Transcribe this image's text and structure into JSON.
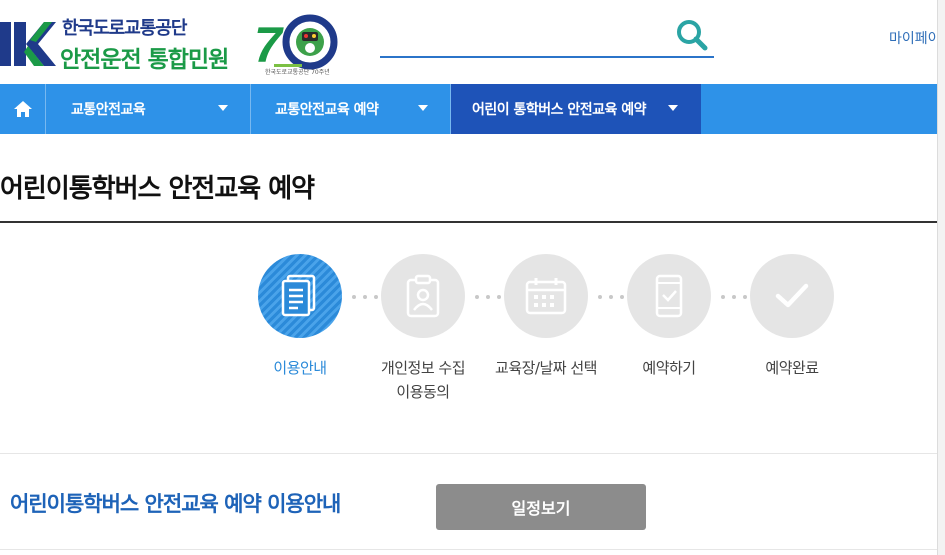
{
  "header": {
    "org_name": "한국도로교통공단",
    "site_name": "안전운전 통합민원",
    "anniversary_caption": "한국도로교통공단 70주년",
    "search": {
      "value": "",
      "placeholder": ""
    },
    "mypage_label": "마이페이"
  },
  "nav": {
    "items": [
      {
        "label": "교통안전교육"
      },
      {
        "label": "교통안전교육 예약"
      },
      {
        "label": "어린이 통학버스 안전교육 예약",
        "active": true
      }
    ]
  },
  "page_title": "어린이통학버스 안전교육 예약",
  "steps": [
    {
      "label": "이용안내",
      "icon": "document-icon",
      "active": true
    },
    {
      "label": "개인정보 수집\n이용동의",
      "icon": "id-card-icon",
      "active": false
    },
    {
      "label": "교육장/날짜 선택",
      "icon": "calendar-icon",
      "active": false
    },
    {
      "label": "예약하기",
      "icon": "mobile-check-icon",
      "active": false
    },
    {
      "label": "예약완료",
      "icon": "checkmark-icon",
      "active": false
    }
  ],
  "section": {
    "title": "어린이통학버스 안전교육 예약 이용안내",
    "schedule_button": "일정보기"
  },
  "colors": {
    "nav_bg": "#2e92e8",
    "nav_active": "#1e53b8",
    "accent_blue": "#2b8ad9",
    "brand_green": "#1b9a47",
    "brand_navy": "#1f3a8a",
    "button_gray": "#8c8c8c"
  }
}
